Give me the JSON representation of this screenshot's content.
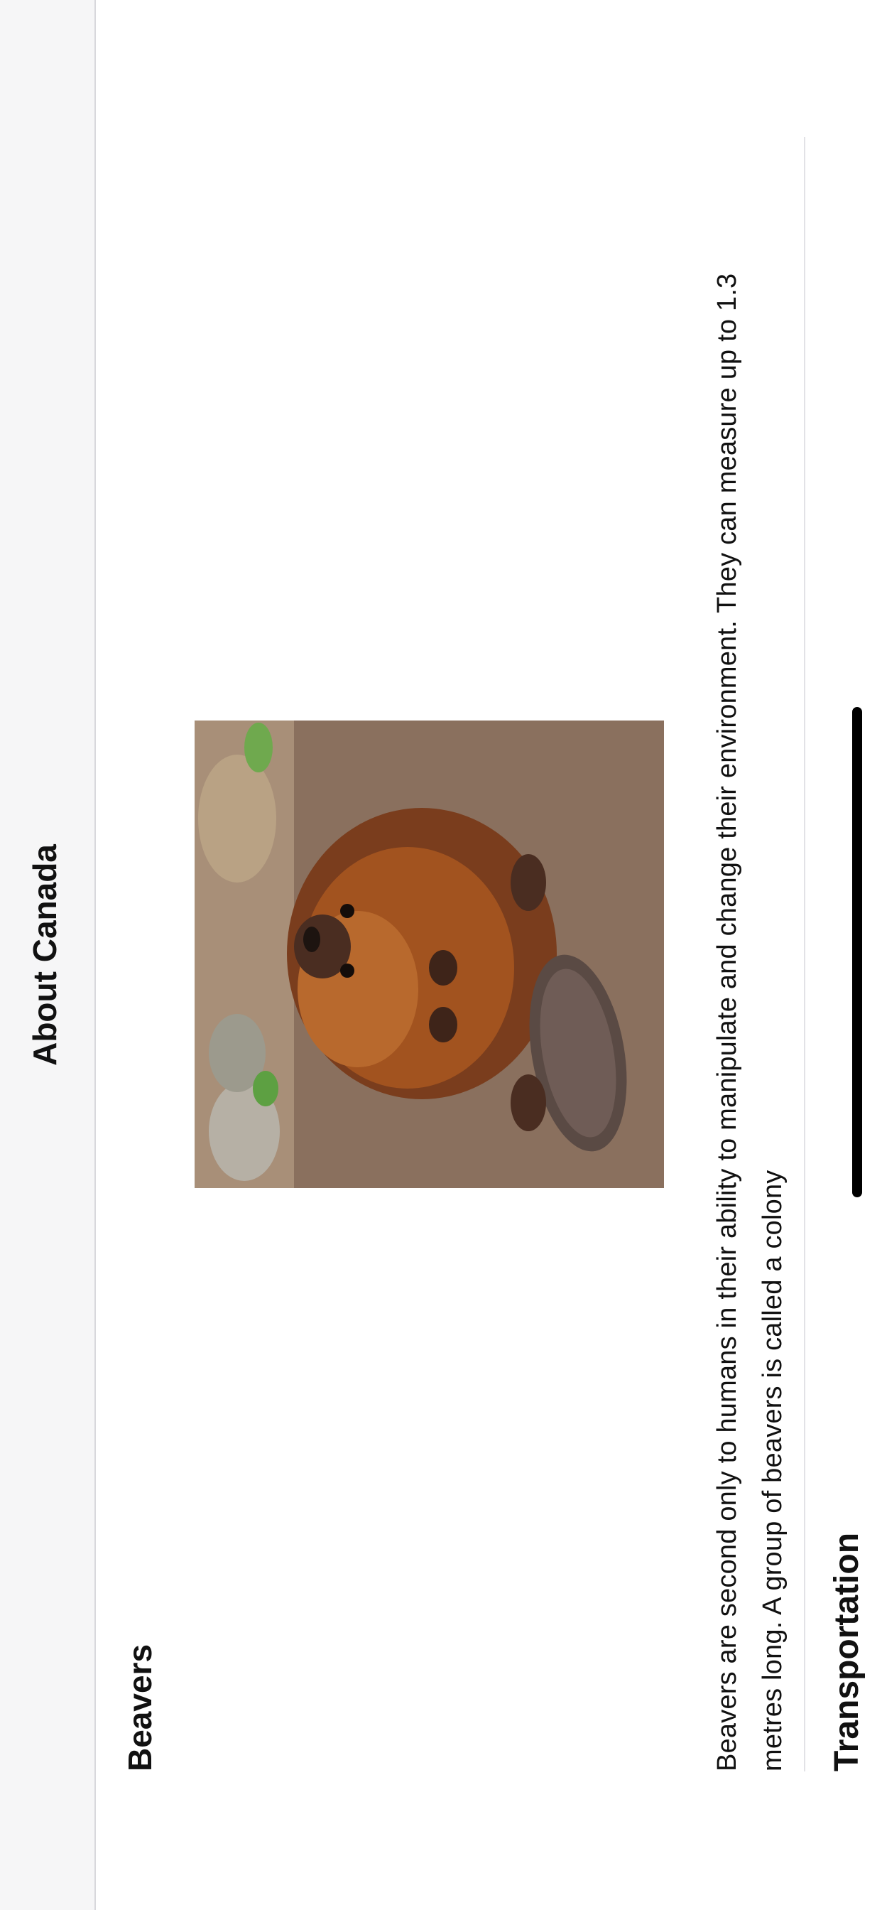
{
  "nav": {
    "title": "About Canada"
  },
  "sections": [
    {
      "heading": "Beavers",
      "image_alt": "Beaver sitting on dirt ground with flat tail",
      "description": "Beavers are second only to humans in their ability to manipulate and change their environment.  They can measure up to 1.3 metres long. A group of beavers is called a colony"
    },
    {
      "heading": "Transportation"
    }
  ],
  "colors": {
    "navbar_bg": "#f6f6f7",
    "text": "#111111",
    "divider": "#e2e2e6"
  }
}
